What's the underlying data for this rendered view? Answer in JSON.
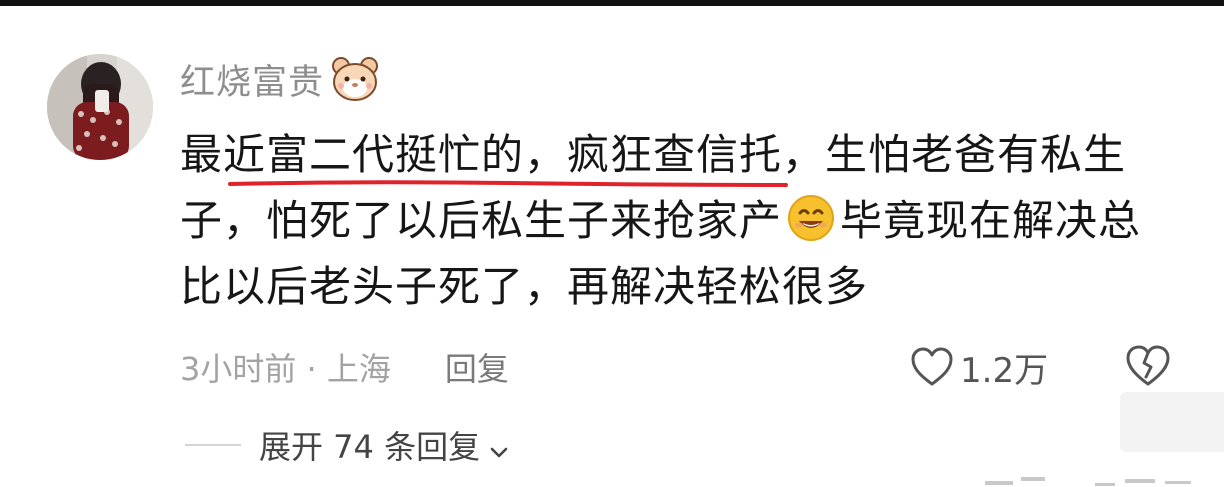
{
  "comment": {
    "username": "红烧富贵",
    "username_badge_icon": "hamster-face-icon",
    "lines": [
      "最近富二代挺忙的，疯狂查信托，生怕老爸有私生",
      "子，怕死了以后私生子来抢家产",
      "毕竟现在解决总",
      "比以后老头子死了，再解决轻松很多"
    ],
    "inline_emoji": "smile-emoji-icon",
    "underline_color": "#e0232a",
    "time_location": "3小时前 · 上海",
    "reply_label": "回复",
    "like_count": "1.2万",
    "like_icon": "heart-outline-icon",
    "dislike_icon": "broken-heart-icon"
  },
  "replies": {
    "expand_label": "展开 74 条回复"
  }
}
